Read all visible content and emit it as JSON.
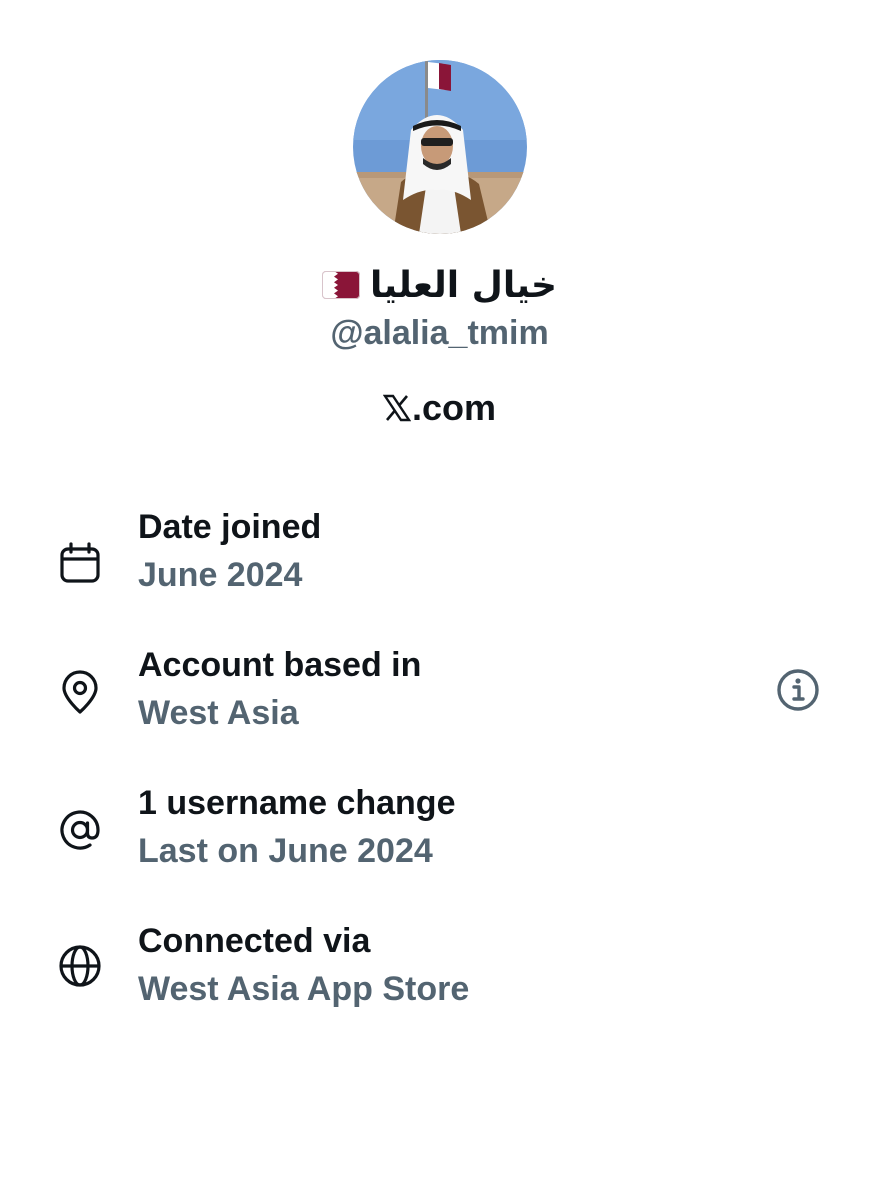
{
  "profile": {
    "display_name": "خيال العليا",
    "flag_icon": "qatar-flag-icon",
    "handle": "@alalia_tmim",
    "site": ".com",
    "site_logo_icon": "x-logo-icon"
  },
  "about": {
    "rows": [
      {
        "icon": "calendar-icon",
        "title": "Date joined",
        "value": "June 2024"
      },
      {
        "icon": "location-pin-icon",
        "title": "Account based in",
        "value": "West Asia",
        "trailing_icon": "info-icon"
      },
      {
        "icon": "at-sign-icon",
        "title": "1 username change",
        "value": "Last on June 2024"
      },
      {
        "icon": "globe-icon",
        "title": "Connected via",
        "value": "West Asia App Store"
      }
    ]
  },
  "colors": {
    "primary_text": "#0f1419",
    "secondary_text": "#536471",
    "flag_maroon": "#8a1538",
    "background": "#ffffff"
  }
}
